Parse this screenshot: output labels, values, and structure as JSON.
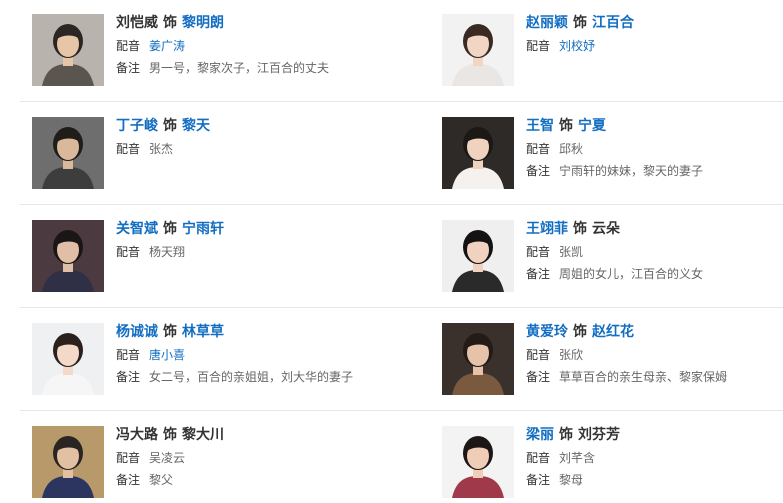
{
  "cast": [
    {
      "left": {
        "actor": "刘恺威",
        "actor_link": false,
        "shi": "饰",
        "role": "黎明朗",
        "role_link": true,
        "dub_label": "配音",
        "dub": "姜广涛",
        "dub_link": true,
        "note_label": "备注",
        "note": "男一号，黎家次子，江百合的丈夫",
        "photo": {
          "bg": "#b8b4ad",
          "skin": "#e7c6a8",
          "hair": "#2b2623",
          "cloth": "#5a564f"
        }
      },
      "right": {
        "actor": "赵丽颖",
        "actor_link": true,
        "shi": "饰",
        "role": "江百合",
        "role_link": true,
        "dub_label": "配音",
        "dub": "刘校妤",
        "dub_link": true,
        "note_label": "",
        "note": "",
        "photo": {
          "bg": "#f2f2f2",
          "skin": "#f1d6c4",
          "hair": "#3a2a22",
          "cloth": "#e9e6e3"
        }
      }
    },
    {
      "left": {
        "actor": "丁子峻",
        "actor_link": true,
        "shi": "饰",
        "role": "黎天",
        "role_link": true,
        "dub_label": "配音",
        "dub": "张杰",
        "dub_link": false,
        "note_label": "",
        "note": "",
        "photo": {
          "bg": "#6e6e6e",
          "skin": "#d9b89c",
          "hair": "#1f1c1a",
          "cloth": "#3d3d3d"
        }
      },
      "right": {
        "actor": "王智",
        "actor_link": true,
        "shi": "饰",
        "role": "宁夏",
        "role_link": true,
        "dub_label": "配音",
        "dub": "邱秋",
        "dub_link": false,
        "note_label": "备注",
        "note": "宁雨轩的妹妹，黎天的妻子",
        "photo": {
          "bg": "#2e2a28",
          "skin": "#f0d3bf",
          "hair": "#1c1816",
          "cloth": "#f4f1ee"
        }
      }
    },
    {
      "left": {
        "actor": "关智斌",
        "actor_link": true,
        "shi": "饰",
        "role": "宁雨轩",
        "role_link": true,
        "dub_label": "配音",
        "dub": "杨天翔",
        "dub_link": false,
        "note_label": "",
        "note": "",
        "photo": {
          "bg": "#4b3b40",
          "skin": "#e0bfa6",
          "hair": "#1a1616",
          "cloth": "#2f2f45"
        }
      },
      "right": {
        "actor": "王翊菲",
        "actor_link": true,
        "shi": "饰",
        "role": "云朵",
        "role_link": false,
        "dub_label": "配音",
        "dub": "张凯",
        "dub_link": false,
        "note_label": "备注",
        "note": "周姐的女儿，江百合的义女",
        "photo": {
          "bg": "#efefef",
          "skin": "#f1d2c0",
          "hair": "#141212",
          "cloth": "#2a2a2a"
        }
      }
    },
    {
      "left": {
        "actor": "杨诚诚",
        "actor_link": true,
        "shi": "饰",
        "role": "林草草",
        "role_link": true,
        "dub_label": "配音",
        "dub": "唐小喜",
        "dub_link": true,
        "note_label": "备注",
        "note": "女二号，百合的亲姐姐，刘大华的妻子",
        "photo": {
          "bg": "#eef0f2",
          "skin": "#f3d9c8",
          "hair": "#2a211d",
          "cloth": "#f6f6f6"
        }
      },
      "right": {
        "actor": "黄爱玲",
        "actor_link": true,
        "shi": "饰",
        "role": "赵红花",
        "role_link": true,
        "dub_label": "配音",
        "dub": "张欣",
        "dub_link": false,
        "note_label": "备注",
        "note": "草草百合的亲生母亲、黎家保姆",
        "photo": {
          "bg": "#3a302c",
          "skin": "#e5c2a8",
          "hair": "#241a16",
          "cloth": "#7a5a3f"
        }
      }
    },
    {
      "left": {
        "actor": "冯大路",
        "actor_link": false,
        "shi": "饰",
        "role": "黎大川",
        "role_link": false,
        "dub_label": "配音",
        "dub": "吴凌云",
        "dub_link": false,
        "note_label": "备注",
        "note": "黎父",
        "photo": {
          "bg": "#b89a6a",
          "skin": "#e2c0a2",
          "hair": "#2a2422",
          "cloth": "#2b3560"
        }
      },
      "right": {
        "actor": "梁丽",
        "actor_link": true,
        "shi": "饰",
        "role": "刘芬芳",
        "role_link": false,
        "dub_label": "配音",
        "dub": "刘芊含",
        "dub_link": false,
        "note_label": "备注",
        "note": "黎母",
        "photo": {
          "bg": "#f3f3f3",
          "skin": "#f0cdb6",
          "hair": "#1c1716",
          "cloth": "#a03a4a"
        }
      }
    }
  ]
}
